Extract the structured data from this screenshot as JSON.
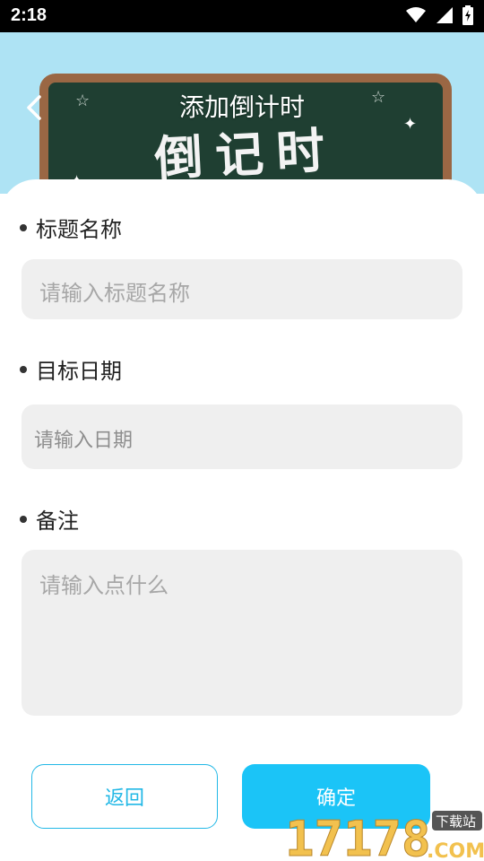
{
  "status_bar": {
    "time": "2:18"
  },
  "header": {
    "title": "添加倒计时",
    "banner_lettering": "倒记时"
  },
  "form": {
    "title_field": {
      "label": "标题名称",
      "placeholder": "请输入标题名称"
    },
    "date_field": {
      "label": "目标日期",
      "placeholder": "请输入日期"
    },
    "note_field": {
      "label": "备注",
      "placeholder": "请输入点什么"
    }
  },
  "buttons": {
    "back_label": "返回",
    "confirm_label": "确定"
  },
  "watermark": {
    "number": "17178",
    "domain": ".COM",
    "tag": "下载站"
  },
  "colors": {
    "accent": "#1bc4f7",
    "header_bg": "#aee3f4",
    "input_bg": "#efefef",
    "board": "#1f3f32"
  }
}
